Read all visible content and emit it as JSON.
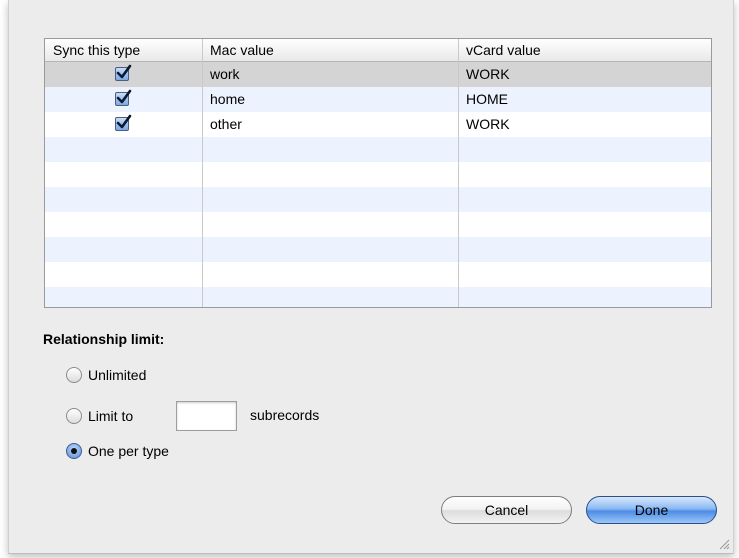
{
  "table": {
    "columns": [
      "Sync this type",
      "Mac value",
      "vCard value"
    ],
    "rows": [
      {
        "sync": true,
        "mac": "work",
        "vcard": "WORK"
      },
      {
        "sync": true,
        "mac": "home",
        "vcard": "HOME"
      },
      {
        "sync": true,
        "mac": "other",
        "vcard": "WORK"
      }
    ]
  },
  "relationship": {
    "label": "Relationship limit:",
    "options": [
      "Unlimited",
      "Limit to",
      "One per type"
    ],
    "selected": "One per type",
    "limit_value": "",
    "limit_suffix": "subrecords"
  },
  "buttons": {
    "cancel": "Cancel",
    "done": "Done"
  },
  "colors": {
    "selected_row": "#d4d4d4",
    "stripe": "#edf3fe",
    "default_button": "#4d8ce5"
  }
}
